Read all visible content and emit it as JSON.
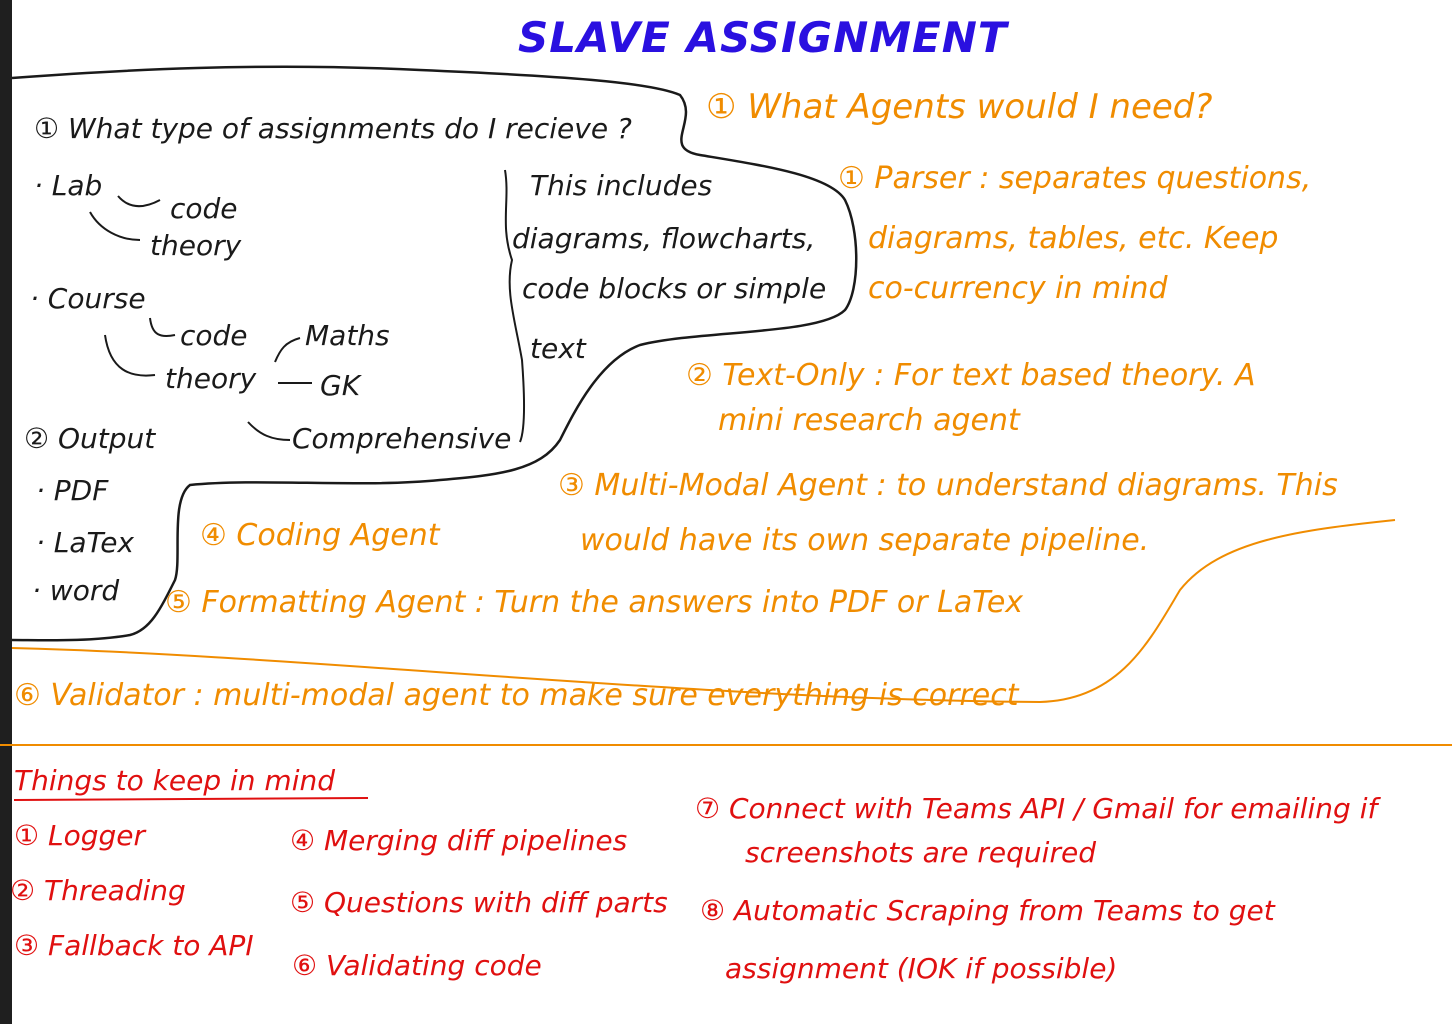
{
  "title": "SLAVE ASSIGNMENT",
  "colors": {
    "black": "#1a1a1a",
    "orange": "#f08c00",
    "red": "#e01010",
    "blue": "#2a10e0"
  },
  "questions": {
    "q1": "① What type of assignments do I recieve ?",
    "lab": "· Lab",
    "lab_code": "code",
    "lab_theory": "theory",
    "course": "· Course",
    "course_code": "code",
    "course_theory": "theory",
    "maths": "Maths",
    "gk": "GK",
    "comprehensive": "Comprehensive",
    "includes": [
      "This includes",
      "diagrams, flowcharts,",
      "code blocks or simple",
      "text"
    ],
    "q2": "② Output",
    "outputs": [
      "· PDF",
      "· LaTex",
      "· word"
    ]
  },
  "agents": {
    "heading": "① What Agents would I need?",
    "parser": [
      "① Parser : separates questions,",
      "diagrams, tables, etc. Keep",
      "co-currency in mind"
    ],
    "text_only": [
      "② Text-Only : For text based theory. A",
      "mini research agent"
    ],
    "multi_modal": [
      "③ Multi-Modal Agent : to understand diagrams. This",
      "would have its own separate pipeline."
    ],
    "coding": "④ Coding Agent",
    "formatting": "⑤ Formatting Agent : Turn the answers into PDF or LaTex",
    "validator": "⑥ Validator : multi-modal agent to make sure everything is correct"
  },
  "keep_in_mind": {
    "heading": "Things to keep in mind",
    "col1": [
      "① Logger",
      "② Threading",
      "③ Fallback to API"
    ],
    "col2": [
      "④ Merging diff pipelines",
      "⑤ Questions with diff parts",
      "⑥ Validating code"
    ],
    "item7": [
      "⑦ Connect with Teams API / Gmail for emailing if",
      "screenshots are required"
    ],
    "item8": [
      "⑧ Automatic Scraping from Teams to get",
      "assignment (IOK if possible)"
    ]
  }
}
